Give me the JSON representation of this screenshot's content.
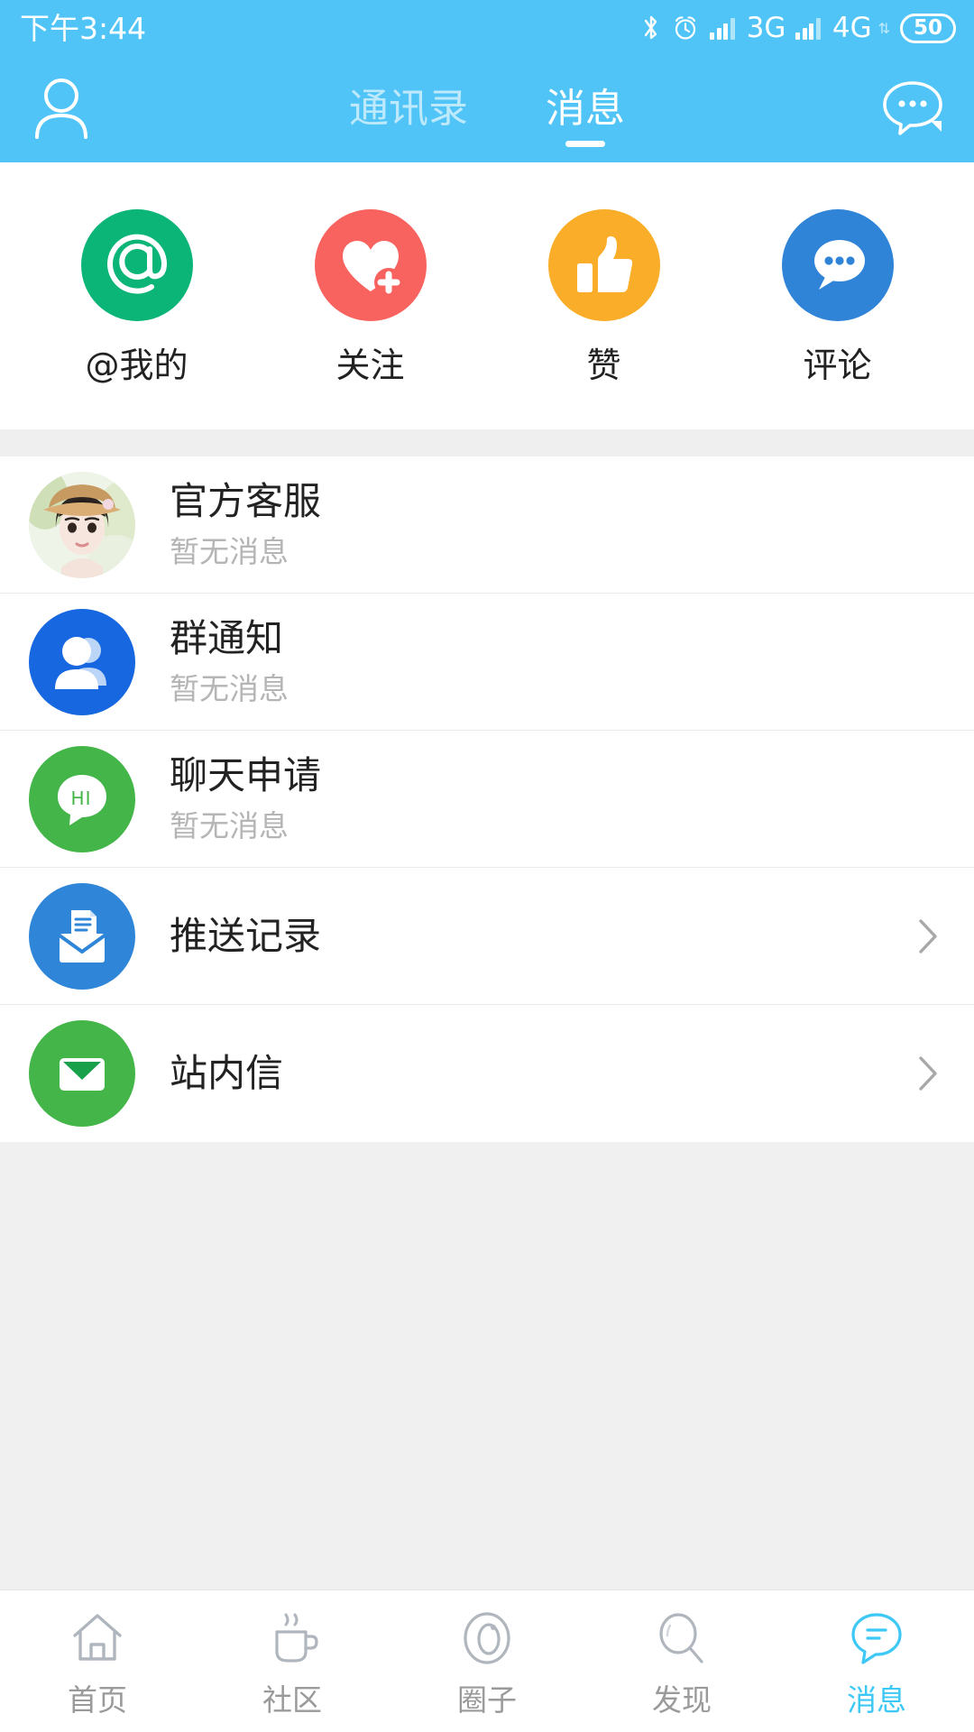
{
  "status_bar": {
    "time": "下午3:44",
    "bluetooth_icon": "bluetooth-icon",
    "alarm_icon": "alarm-clock-icon",
    "sim1_network": "3G",
    "sim2_network": "4G",
    "battery_level": "50"
  },
  "header": {
    "profile_icon": "person-icon",
    "chat_icon": "chat-bubble-icon",
    "tabs": [
      {
        "label": "通讯录",
        "active": false
      },
      {
        "label": "消息",
        "active": true
      }
    ]
  },
  "quick_actions": [
    {
      "label": "@我的",
      "icon": "at-icon",
      "color": "#0bb578"
    },
    {
      "label": "关注",
      "icon": "heart-plus-icon",
      "color": "#f8635f"
    },
    {
      "label": "赞",
      "icon": "thumbs-up-icon",
      "color": "#f9ad28"
    },
    {
      "label": "评论",
      "icon": "comment-bubble-icon",
      "color": "#2f84d8"
    }
  ],
  "messages": [
    {
      "title": "官方客服",
      "subtitle": "暂无消息",
      "icon": "avatar-photo",
      "color": "#e8efe4",
      "chevron": false
    },
    {
      "title": "群通知",
      "subtitle": "暂无消息",
      "icon": "group-people-icon",
      "color": "#1667e0",
      "chevron": false
    },
    {
      "title": "聊天申请",
      "subtitle": "暂无消息",
      "icon": "hi-bubble-icon",
      "color": "#44b649",
      "chevron": false
    },
    {
      "title": "推送记录",
      "subtitle": "",
      "icon": "push-envelope-icon",
      "color": "#2f86d8",
      "chevron": true
    },
    {
      "title": "站内信",
      "subtitle": "",
      "icon": "mail-envelope-icon",
      "color": "#44b649",
      "chevron": true
    }
  ],
  "bottom_nav": [
    {
      "label": "首页",
      "icon": "home-icon",
      "active": false
    },
    {
      "label": "社区",
      "icon": "coffee-cup-icon",
      "active": false
    },
    {
      "label": "圈子",
      "icon": "circle-swirl-icon",
      "active": false
    },
    {
      "label": "发现",
      "icon": "magnifier-icon",
      "active": false
    },
    {
      "label": "消息",
      "icon": "message-bubble-icon",
      "active": true
    }
  ],
  "colors": {
    "header_blue": "#50c4f7",
    "accent_blue": "#3dc8f5",
    "page_background": "#f0f0f0",
    "card_background": "#ffffff",
    "divider": "#e9e9e9"
  }
}
